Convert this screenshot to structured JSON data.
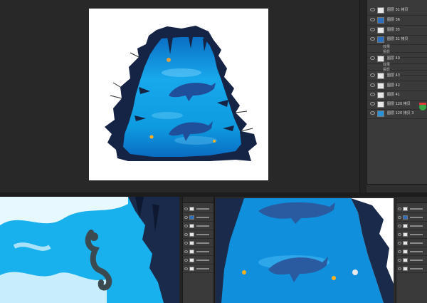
{
  "app": {
    "name": "Photoshop",
    "accent": "#4a5060"
  },
  "layers_panel": {
    "layers": [
      {
        "label": "图层 31 拷贝",
        "type": "layer",
        "selected": false
      },
      {
        "label": "图层 36",
        "type": "layer",
        "selected": false
      },
      {
        "label": "图层 35",
        "type": "layer",
        "selected": false
      },
      {
        "label": "图层 31 拷贝",
        "type": "layer",
        "selected": false
      },
      {
        "label": "效果",
        "type": "effect",
        "selected": false
      },
      {
        "label": "投影",
        "type": "effect",
        "selected": false
      },
      {
        "label": "图层 40",
        "type": "layer",
        "selected": false
      },
      {
        "label": "效果",
        "type": "effect",
        "selected": false
      },
      {
        "label": "投影",
        "type": "effect",
        "selected": false
      },
      {
        "label": "图层 43",
        "type": "layer",
        "selected": false
      },
      {
        "label": "图层 42",
        "type": "layer",
        "selected": false
      },
      {
        "label": "图层 41",
        "type": "layer",
        "selected": false
      },
      {
        "label": "图层 120 拷贝",
        "type": "layer",
        "selected": false
      },
      {
        "label": "图层 120 拷贝 3",
        "type": "layer",
        "selected": false
      }
    ]
  },
  "icons": [
    "eye-icon",
    "layer-thumbnail",
    "fx-icon",
    "sticker-badge-icon"
  ]
}
